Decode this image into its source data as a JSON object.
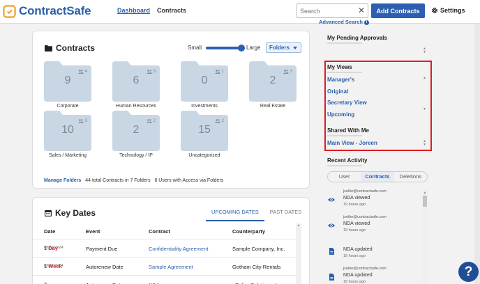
{
  "header": {
    "logo_text": "ContractSafe",
    "nav": [
      {
        "label": "Dashboard"
      },
      {
        "label": "Contracts"
      }
    ],
    "search_placeholder": "Search",
    "advanced_search": "Advanced Search",
    "add_contracts": "Add Contracts",
    "settings": "Settings"
  },
  "contracts": {
    "title": "Contracts",
    "size_small": "Small",
    "size_large": "Large",
    "view_select": "Folders",
    "folders": [
      {
        "count": "9",
        "shared": "4",
        "name": "Corporate"
      },
      {
        "count": "6",
        "shared": "3",
        "name": "Human Resources"
      },
      {
        "count": "0",
        "shared": "1",
        "name": "Investments"
      },
      {
        "count": "2",
        "shared": "3",
        "name": "Real Estate"
      },
      {
        "count": "10",
        "shared": "3",
        "name": "Sales / Marketing"
      },
      {
        "count": "2",
        "shared": "2",
        "name": "Technology / IP"
      },
      {
        "count": "15",
        "shared": "2",
        "name": "Uncategorized"
      }
    ],
    "manage_folders": "Manage Folders",
    "summary": "44 total Contracts in 7 Folders   6 Users with Access via Folders"
  },
  "key_dates": {
    "title": "Key Dates",
    "tabs": [
      {
        "label": "UPCOMING DATES"
      },
      {
        "label": "PAST DATES"
      }
    ],
    "columns": [
      "Date",
      "Event",
      "Contract",
      "Counterparty"
    ],
    "rows": [
      {
        "due": "1 Day",
        "date": "08/23/2024",
        "event": "Payment Due",
        "contract": "Confidentiality Agreement",
        "counterparty": "Sample Company, Inc."
      },
      {
        "due": "1 Week",
        "date": "09/02/2024",
        "event": "Autorenew Date",
        "contract": "Sample Agreement",
        "counterparty": "Gotham City Rentals"
      },
      {
        "due": "2 Weeks",
        "date": "",
        "event": "Autorenew Date",
        "contract": "NDA",
        "counterparty": "ePolicy Solutions, Inc."
      }
    ]
  },
  "sidebar": {
    "pending_title": "My Pending Approvals",
    "my_views_title": "My Views",
    "views": [
      {
        "label": "Manager's"
      },
      {
        "label": "Original"
      },
      {
        "label": "Secretary View"
      },
      {
        "label": "Upcoming"
      }
    ],
    "shared_title": "Shared With Me",
    "shared_views": [
      {
        "label": "Main View - Joreen"
      }
    ],
    "recent_title": "Recent Activity",
    "segments": [
      {
        "label": "User"
      },
      {
        "label": "Contracts"
      },
      {
        "label": "Deletions"
      }
    ],
    "activity": [
      {
        "email": "jsoller@contractsafe.com",
        "message": "NDA viewed",
        "time": "19 hours ago",
        "icon": "eye-icon"
      },
      {
        "email": "jsoller@contractsafe.com",
        "message": "NDA viewed",
        "time": "19 hours ago",
        "icon": "eye-icon"
      },
      {
        "email": "",
        "message": "NDA updated",
        "time": "19 hours ago",
        "icon": "document-icon"
      },
      {
        "email": "jsoller@contractsafe.com",
        "message": "NDA updated",
        "time": "19 hours ago",
        "icon": "document-icon"
      }
    ]
  },
  "help": "?",
  "colors": {
    "brand_blue": "#2c5fb0",
    "highlight_red": "#e01b22",
    "folder": "#c9d7e5",
    "due_red": "#d9262c"
  }
}
